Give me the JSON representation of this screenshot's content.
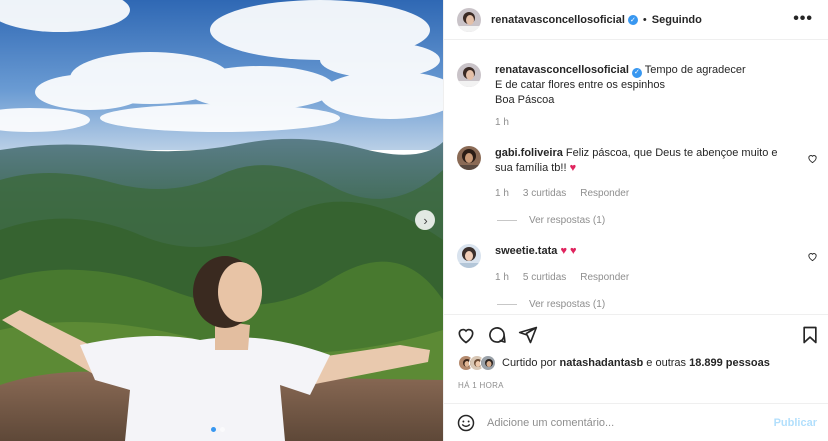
{
  "header": {
    "username": "renatavasconcellosoficial",
    "separator": "•",
    "following": "Seguindo",
    "more": "•••"
  },
  "caption": {
    "username": "renatavasconcellosoficial",
    "lines": [
      "Tempo de agradecer",
      "E de catar flores entre os espinhos",
      "Boa Páscoa"
    ],
    "time": "1 h"
  },
  "comments": [
    {
      "username": "gabi.foliveira",
      "text": "Feliz páscoa, que Deus te abençoe muito e sua família tb!!",
      "emoji": "♥",
      "time": "1 h",
      "likes": "3 curtidas",
      "reply": "Responder",
      "view_replies": "Ver respostas (1)"
    },
    {
      "username": "sweetie.tata",
      "text": "",
      "emoji": "♥ ♥",
      "time": "1 h",
      "likes": "5 curtidas",
      "reply": "Responder",
      "view_replies": "Ver respostas (1)"
    }
  ],
  "likes": {
    "prefix": "Curtido por",
    "user": "natashadantasb",
    "suffix": "e outras",
    "count": "18.899 pessoas"
  },
  "time_ago": "HÁ 1 HORA",
  "comment_box": {
    "placeholder": "Adicione um comentário...",
    "publish": "Publicar"
  },
  "carousel": {
    "current": 1,
    "total": 2
  },
  "colors": {
    "verified": "#3897f0",
    "heart": "#e0245e",
    "muted": "#8e8e8e",
    "publish_disabled": "#b2dffc"
  },
  "icons": [
    "verified-badge-icon",
    "more-icon",
    "heart-icon",
    "comment-icon",
    "share-icon",
    "bookmark-icon",
    "emoji-icon",
    "chevron-right-icon"
  ]
}
